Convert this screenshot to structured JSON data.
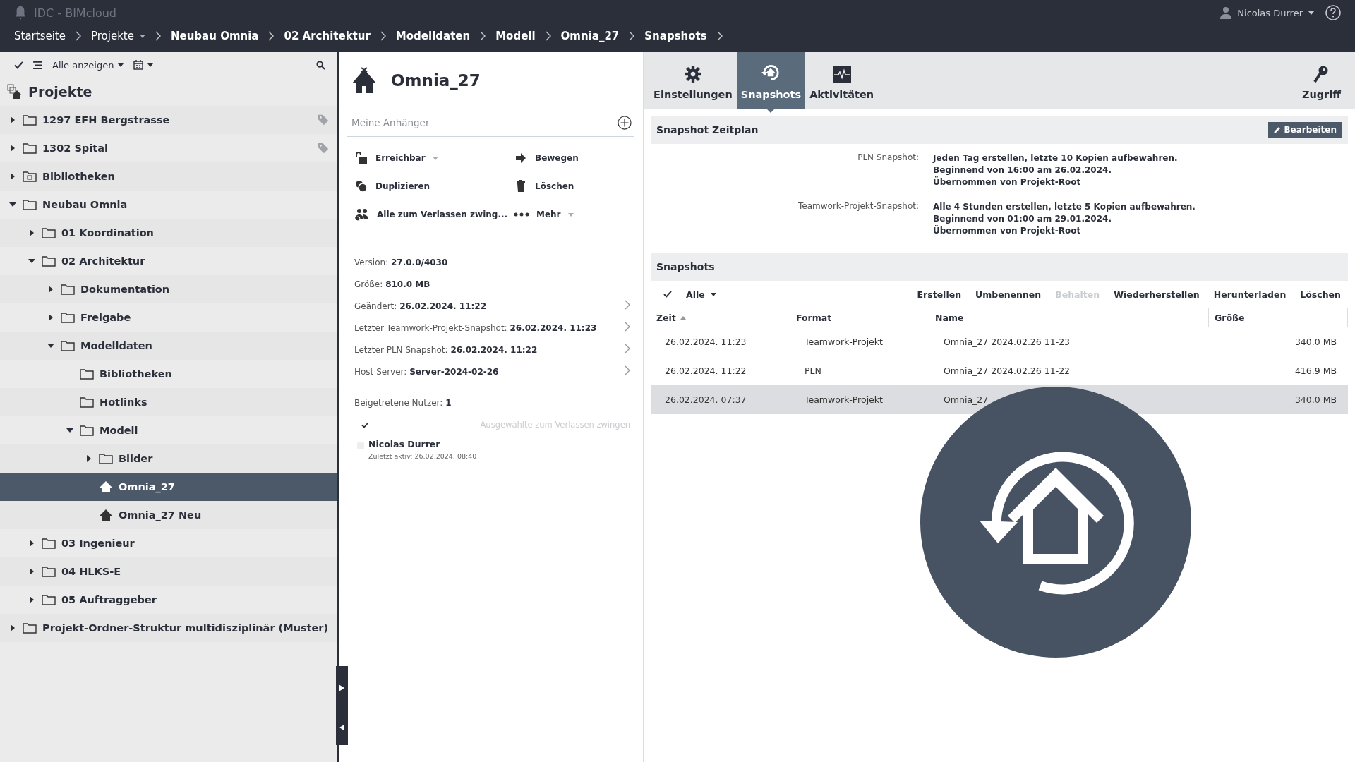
{
  "app": {
    "title": "IDC - BIMcloud",
    "user": "Nicolas Durrer"
  },
  "breadcrumbs": [
    {
      "label": "Startseite",
      "emphasized": false,
      "dropdown": false
    },
    {
      "label": "Projekte",
      "emphasized": false,
      "dropdown": true
    },
    {
      "label": "Neubau Omnia",
      "emphasized": true,
      "dropdown": false
    },
    {
      "label": "02 Architektur",
      "emphasized": true,
      "dropdown": false
    },
    {
      "label": "Modelldaten",
      "emphasized": true,
      "dropdown": false
    },
    {
      "label": "Modell",
      "emphasized": true,
      "dropdown": false
    },
    {
      "label": "Omnia_27",
      "emphasized": true,
      "dropdown": false
    },
    {
      "label": "Snapshots",
      "emphasized": true,
      "dropdown": false
    }
  ],
  "tree_toolbar": {
    "filter": "Alle anzeigen"
  },
  "tree": {
    "title": "Projekte",
    "items": [
      {
        "label": "1297 EFH Bergstrasse",
        "kind": "folder",
        "expanded": false,
        "tagged": true,
        "selected": false
      },
      {
        "label": "1302 Spital",
        "kind": "folder",
        "expanded": false,
        "tagged": true,
        "selected": false
      },
      {
        "label": "Bibliotheken",
        "kind": "library",
        "expanded": false,
        "tagged": false,
        "selected": false
      },
      {
        "label": "Neubau Omnia",
        "kind": "folder",
        "expanded": true,
        "tagged": false,
        "selected": false,
        "children": [
          {
            "label": "01 Koordination",
            "kind": "folder",
            "expanded": false,
            "tagged": false,
            "selected": false
          },
          {
            "label": "02 Architektur",
            "kind": "folder",
            "expanded": true,
            "tagged": false,
            "selected": false,
            "children": [
              {
                "label": "Dokumentation",
                "kind": "folder",
                "expanded": false,
                "tagged": false,
                "selected": false
              },
              {
                "label": "Freigabe",
                "kind": "folder",
                "expanded": false,
                "tagged": false,
                "selected": false
              },
              {
                "label": "Modelldaten",
                "kind": "folder",
                "expanded": true,
                "tagged": false,
                "selected": false,
                "children": [
                  {
                    "label": "Bibliotheken",
                    "kind": "folder",
                    "tagged": false,
                    "selected": false
                  },
                  {
                    "label": "Hotlinks",
                    "kind": "folder",
                    "tagged": false,
                    "selected": false
                  },
                  {
                    "label": "Modell",
                    "kind": "folder",
                    "expanded": true,
                    "tagged": false,
                    "selected": false,
                    "children": [
                      {
                        "label": "Bilder",
                        "kind": "folder",
                        "expanded": false,
                        "tagged": false,
                        "selected": false
                      },
                      {
                        "label": "Omnia_27",
                        "kind": "model",
                        "tagged": false,
                        "selected": true
                      },
                      {
                        "label": "Omnia_27 Neu",
                        "kind": "model",
                        "tagged": false,
                        "selected": false
                      }
                    ]
                  }
                ]
              }
            ]
          },
          {
            "label": "03 Ingenieur",
            "kind": "folder",
            "expanded": false,
            "tagged": false,
            "selected": false
          },
          {
            "label": "04 HLKS-E",
            "kind": "folder",
            "expanded": false,
            "tagged": false,
            "selected": false
          },
          {
            "label": "05 Auftraggeber",
            "kind": "folder",
            "expanded": false,
            "tagged": false,
            "selected": false
          }
        ]
      },
      {
        "label": "Projekt-Ordner-Struktur multidisziplinär (Muster)",
        "kind": "folder",
        "expanded": false,
        "tagged": false,
        "selected": false
      }
    ]
  },
  "detail": {
    "title": "Omnia_27",
    "attachments": {
      "placeholder": "Meine Anhänger"
    },
    "actions": [
      {
        "label": "Erreichbar",
        "kind": "unlock",
        "dropdown": true
      },
      {
        "label": "Bewegen",
        "kind": "move",
        "dropdown": false
      },
      {
        "label": "Duplizieren",
        "kind": "duplicate",
        "dropdown": false
      },
      {
        "label": "Löschen",
        "kind": "delete",
        "dropdown": false
      },
      {
        "label": "Alle zum Verlassen zwing...",
        "kind": "users",
        "dropdown": false
      },
      {
        "label": "Mehr",
        "kind": "more",
        "dropdown": true
      }
    ],
    "info": [
      {
        "label": "Version:",
        "value": "27.0.0/4030",
        "navigable": false
      },
      {
        "label": "Größe:",
        "value": "810.0 MB",
        "navigable": false
      },
      {
        "label": "Geändert:",
        "value": "26.02.2024. 11:22",
        "navigable": true
      },
      {
        "label": "Letzter Teamwork-Projekt-Snapshot:",
        "value": "26.02.2024. 11:23",
        "navigable": true
      },
      {
        "label": "Letzter PLN Snapshot:",
        "value": "26.02.2024. 11:22",
        "navigable": true
      },
      {
        "label": "Host Server:",
        "value": "Server-2024-02-26",
        "navigable": true
      }
    ],
    "joined_users": {
      "label": "Beigetretene Nutzer:",
      "count": "1"
    },
    "force_leave": {
      "label": "Ausgewählte zum Verlassen zwingen",
      "disabled": true
    },
    "users": [
      {
        "name": "Nicolas Durrer",
        "last_active": "Zuletzt aktiv: 26.02.2024. 08:40",
        "checked": false
      }
    ]
  },
  "tabs": [
    {
      "label": "Einstellungen",
      "kind": "gear",
      "selected": false
    },
    {
      "label": "Snapshots",
      "kind": "snapshot",
      "selected": true
    },
    {
      "label": "Aktivitäten",
      "kind": "activity",
      "selected": false
    }
  ],
  "access_tab": {
    "label": "Zugriff"
  },
  "schedule": {
    "title": "Snapshot Zeitplan",
    "edit_button": "Bearbeiten",
    "rows": [
      {
        "label": "PLN Snapshot:",
        "lines": [
          "Jeden Tag erstellen, letzte 10 Kopien aufbewahren.",
          "Beginnend von 16:00 am 26.02.2024.",
          "Übernommen von Projekt-Root"
        ]
      },
      {
        "label": "Teamwork-Projekt-Snapshot:",
        "lines": [
          "Alle 4 Stunden erstellen, letzte 5 Kopien aufbewahren.",
          "Beginnend von 01:00 am 29.01.2024.",
          "Übernommen von Projekt-Root"
        ]
      }
    ]
  },
  "snapshots": {
    "title": "Snapshots",
    "filter": "Alle",
    "actions": [
      {
        "label": "Erstellen",
        "disabled": false
      },
      {
        "label": "Umbenennen",
        "disabled": false
      },
      {
        "label": "Behalten",
        "disabled": true
      },
      {
        "label": "Wiederherstellen",
        "disabled": false
      },
      {
        "label": "Herunterladen",
        "disabled": false
      },
      {
        "label": "Löschen",
        "disabled": false
      }
    ],
    "columns": [
      {
        "label": "Zeit",
        "sorted": true
      },
      {
        "label": "Format",
        "sorted": false
      },
      {
        "label": "Name",
        "sorted": false
      },
      {
        "label": "Größe",
        "sorted": false
      }
    ],
    "rows": [
      {
        "time": "26.02.2024. 11:23",
        "format": "Teamwork-Projekt",
        "name": "Omnia_27 2024.02.26 11-23",
        "size": "340.0 MB",
        "selected": false
      },
      {
        "time": "26.02.2024. 11:22",
        "format": "PLN",
        "name": "Omnia_27 2024.02.26 11-22",
        "size": "416.9 MB",
        "selected": false
      },
      {
        "time": "26.02.2024. 07:37",
        "format": "Teamwork-Projekt",
        "name": "Omnia_27",
        "size": "340.0 MB",
        "selected": true
      }
    ]
  }
}
